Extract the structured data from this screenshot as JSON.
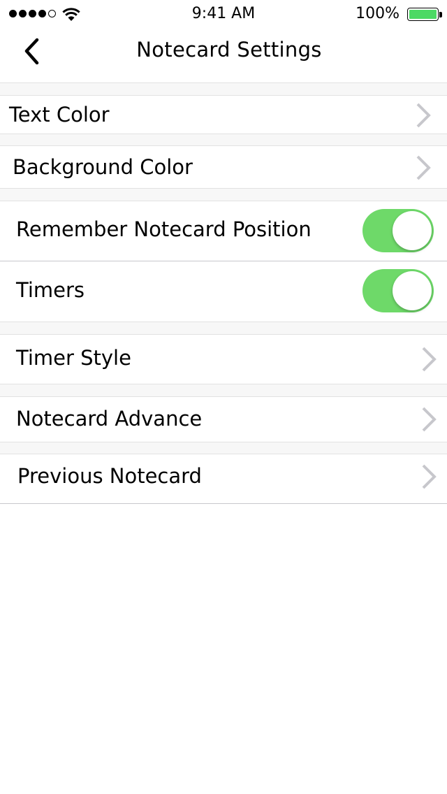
{
  "status_bar": {
    "time": "9:41 AM",
    "battery_percent": "100%",
    "signal_bars_filled": 4,
    "signal_bars_total": 5,
    "battery_level": 1.0,
    "battery_color": "#4cd964",
    "wifi_icon": "wifi-icon"
  },
  "nav": {
    "title": "Notecard Settings",
    "back_icon": "chevron-left-icon"
  },
  "settings": {
    "text_color": "Text Color",
    "background_color": "Background Color",
    "remember_position": {
      "label": "Remember Notecard Position",
      "on": true
    },
    "timers": {
      "label": "Timers",
      "on": true
    },
    "timer_style": "Timer Style",
    "notecard_advance": "Notecard Advance",
    "previous_notecard": "Previous Notecard"
  },
  "colors": {
    "toggle_on": "#6ed969",
    "chevron": "#c7c7cc",
    "group_gap": "#f7f7f7"
  }
}
